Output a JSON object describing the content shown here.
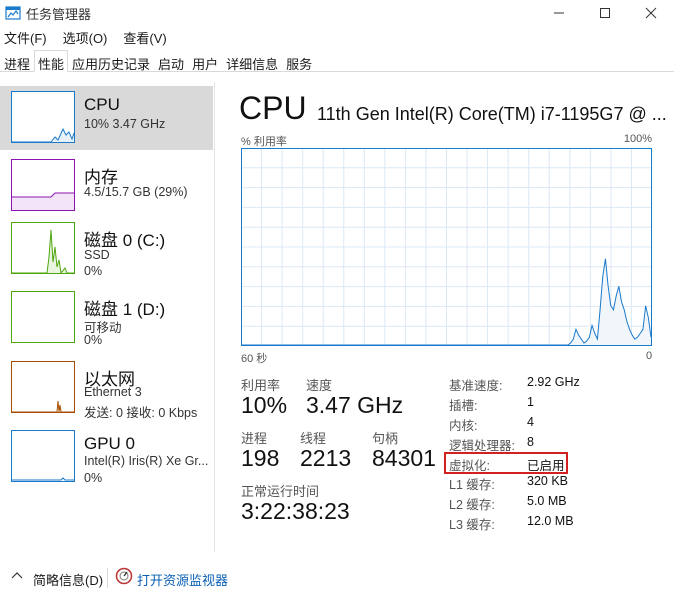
{
  "window": {
    "title": "任务管理器"
  },
  "menu": [
    {
      "label": "文件(F)"
    },
    {
      "label": "选项(O)"
    },
    {
      "label": "查看(V)"
    }
  ],
  "tabs": [
    {
      "label": "进程"
    },
    {
      "label": "性能"
    },
    {
      "label": "应用历史记录"
    },
    {
      "label": "启动"
    },
    {
      "label": "用户"
    },
    {
      "label": "详细信息"
    },
    {
      "label": "服务"
    }
  ],
  "active_tab": "性能",
  "sidebar": {
    "items": [
      {
        "title": "CPU",
        "line1": "10% 3.47 GHz",
        "line2": "",
        "color": "#1979ca"
      },
      {
        "title": "内存",
        "line1": "4.5/15.7 GB (29%)",
        "line2": "",
        "color": "#8b12ae"
      },
      {
        "title": "磁盘 0 (C:)",
        "line1": "SSD",
        "line2": "0%",
        "color": "#4da60c"
      },
      {
        "title": "磁盘 1 (D:)",
        "line1": "可移动",
        "line2": "0%",
        "color": "#4da60c"
      },
      {
        "title": "以太网",
        "line1": "Ethernet 3",
        "line2": "发送: 0 接收: 0 Kbps",
        "color": "#a74f01"
      },
      {
        "title": "GPU 0",
        "line1": "Intel(R) Iris(R) Xe Gr...",
        "line2": "0%",
        "color": "#1979ca"
      }
    ]
  },
  "main": {
    "title": "CPU",
    "model": "11th Gen Intel(R) Core(TM) i7-1195G7 @ ...",
    "graph": {
      "label_left": "% 利用率",
      "label_right": "100%",
      "axis_left": "60 秒",
      "axis_right": "0",
      "utilization_series": [
        0,
        0,
        0,
        0,
        0,
        0,
        0,
        0,
        0,
        0,
        0,
        0,
        0,
        0,
        0,
        0,
        0,
        0,
        0,
        0,
        0,
        0,
        0,
        0,
        0,
        0,
        0,
        0,
        0,
        0,
        0,
        0,
        0,
        0,
        0,
        0,
        0,
        0,
        0,
        0,
        0,
        0,
        0,
        0,
        0,
        0,
        0,
        0,
        0,
        0,
        0,
        0,
        0,
        0,
        0,
        0,
        0,
        0,
        0,
        0,
        0,
        0,
        0,
        0,
        0,
        0,
        0,
        0,
        0,
        0,
        0,
        0,
        0,
        0,
        0,
        0,
        0,
        0,
        0,
        0,
        0,
        0,
        0,
        0,
        0,
        0,
        0,
        0,
        0,
        0,
        0,
        0,
        0,
        0,
        0,
        0,
        0,
        0,
        0,
        0,
        0,
        0,
        0,
        0,
        0,
        0,
        0,
        0,
        0,
        0,
        0,
        0,
        0,
        0,
        0,
        0,
        0,
        0,
        0,
        0,
        0,
        0,
        0,
        1,
        3,
        8,
        5,
        3,
        1,
        2,
        4,
        10,
        6,
        3,
        18,
        35,
        44,
        30,
        20,
        18,
        25,
        30,
        22,
        18,
        12,
        8,
        5,
        3,
        4,
        6,
        8,
        20,
        14,
        4
      ],
      "line_color": "#1979ca",
      "fill_color": "#f1f6fb"
    },
    "stats": {
      "util_label": "利用率",
      "util_value": "10%",
      "speed_label": "速度",
      "speed_value": "3.47 GHz",
      "proc_label": "进程",
      "proc_value": "198",
      "thread_label": "线程",
      "thread_value": "2213",
      "handle_label": "句柄",
      "handle_value": "84301",
      "uptime_label": "正常运行时间",
      "uptime_value": "3:22:38:23"
    },
    "details": [
      {
        "label": "基准速度:",
        "value": "2.92 GHz"
      },
      {
        "label": "插槽:",
        "value": "1"
      },
      {
        "label": "内核:",
        "value": "4"
      },
      {
        "label": "逻辑处理器:",
        "value": "8"
      },
      {
        "label": "虚拟化:",
        "value": "已启用"
      },
      {
        "label": "L1 缓存:",
        "value": "320 KB"
      },
      {
        "label": "L2 缓存:",
        "value": "5.0 MB"
      },
      {
        "label": "L3 缓存:",
        "value": "12.0 MB"
      }
    ],
    "highlight_color": "#d32020"
  },
  "footer": {
    "less_details": "简略信息(D)",
    "open_monitor": "打开资源监视器"
  }
}
